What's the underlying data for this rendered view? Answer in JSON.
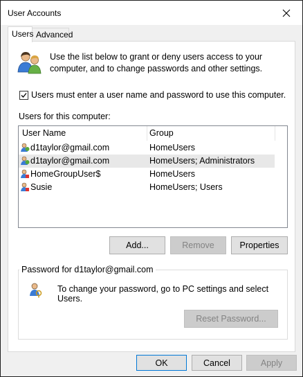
{
  "window": {
    "title": "User Accounts"
  },
  "tabs": [
    {
      "label": "Users",
      "active": true
    },
    {
      "label": "Advanced",
      "active": false
    }
  ],
  "intro": {
    "text": "Use the list below to grant or deny users access to your computer, and to change passwords and other settings."
  },
  "login_checkbox": {
    "label": "Users must enter a user name and password to use this computer.",
    "checked": true
  },
  "users_list": {
    "label": "Users for this computer:",
    "columns": [
      "User Name",
      "Group"
    ],
    "rows": [
      {
        "name": "d1taylor@gmail.com",
        "group": "HomeUsers",
        "selected": false
      },
      {
        "name": "d1taylor@gmail.com",
        "group": "HomeUsers; Administrators",
        "selected": true
      },
      {
        "name": "HomeGroupUser$",
        "group": "HomeUsers",
        "selected": false
      },
      {
        "name": "Susie",
        "group": "HomeUsers; Users",
        "selected": false
      }
    ]
  },
  "list_buttons": {
    "add": "Add...",
    "remove": "Remove",
    "properties": "Properties"
  },
  "password_group": {
    "title": "Password for d1taylor@gmail.com",
    "text": "To change your password, go to PC settings and select Users.",
    "reset_button": "Reset Password..."
  },
  "dialog_buttons": {
    "ok": "OK",
    "cancel": "Cancel",
    "apply": "Apply"
  }
}
